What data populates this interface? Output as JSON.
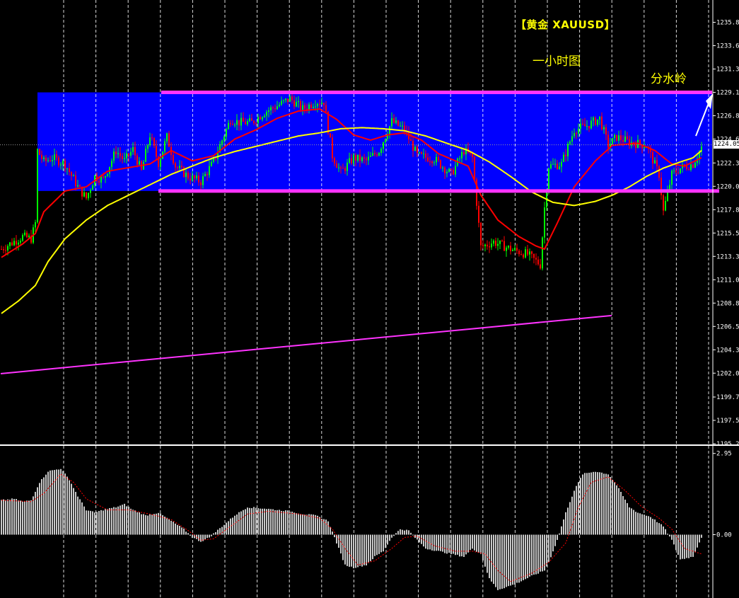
{
  "annotations": {
    "title": "【黄金 XAUUSD】",
    "timeframe": "一小时图",
    "watershed": "分水岭"
  },
  "current_price": "1224.05",
  "colors": {
    "background": "#000000",
    "range_box": "#0000ff",
    "range_lines": "#ff33ff",
    "trend_line": "#ff33ff",
    "bull_candle": "#00ff00",
    "bear_candle": "#ff0000",
    "ma_fast": "#ff0000",
    "ma_slow": "#ffff00",
    "macd_hist": "#c8c8c8",
    "macd_signal": "#ff0000",
    "grid": "#ffffff",
    "text": "#ffffff"
  },
  "chart_data": [
    {
      "type": "candlestick",
      "panel": "price",
      "ylim": [
        1195.25,
        1238.0
      ],
      "y_ticks": [
        "1235.85",
        "1233.60",
        "1231.35",
        "1229.10",
        "1226.85",
        "1224.60",
        "1222.30",
        "1220.05",
        "1217.80",
        "1215.55",
        "1213.30",
        "1211.05",
        "1208.80",
        "1206.55",
        "1204.30",
        "1202.05",
        "1199.75",
        "1197.50",
        "1195.25"
      ],
      "range_box": {
        "upper": 1229.1,
        "lower": 1219.6
      },
      "resistance": 1229.1,
      "support": 1219.6,
      "trend_line": {
        "start_bar": 0,
        "start_price": 1202.0,
        "end_bar": 288,
        "end_price": 1207.6
      },
      "candles": [],
      "anchors": [
        [
          0,
          1214.0
        ],
        [
          4,
          1214.5
        ],
        [
          10,
          1215.2
        ],
        [
          14,
          1215.0
        ],
        [
          16,
          1216.5
        ],
        [
          17,
          1223.5
        ],
        [
          20,
          1222.4
        ],
        [
          24,
          1222.8
        ],
        [
          30,
          1222.2
        ],
        [
          36,
          1220.0
        ],
        [
          40,
          1218.9
        ],
        [
          44,
          1221.0
        ],
        [
          48,
          1220.7
        ],
        [
          54,
          1223.5
        ],
        [
          58,
          1222.5
        ],
        [
          62,
          1223.6
        ],
        [
          66,
          1221.5
        ],
        [
          70,
          1225.0
        ],
        [
          74,
          1222.3
        ],
        [
          78,
          1224.8
        ],
        [
          82,
          1222.0
        ],
        [
          88,
          1221.0
        ],
        [
          94,
          1220.5
        ],
        [
          100,
          1222.4
        ],
        [
          104,
          1224.5
        ],
        [
          108,
          1226.5
        ],
        [
          112,
          1226.2
        ],
        [
          118,
          1226.2
        ],
        [
          124,
          1227.2
        ],
        [
          130,
          1227.8
        ],
        [
          136,
          1228.5
        ],
        [
          142,
          1227.5
        ],
        [
          148,
          1228.2
        ],
        [
          152,
          1228.2
        ],
        [
          156,
          1223.0
        ],
        [
          160,
          1221.4
        ],
        [
          166,
          1222.8
        ],
        [
          172,
          1222.5
        ],
        [
          178,
          1223.5
        ],
        [
          184,
          1226.3
        ],
        [
          190,
          1225.5
        ],
        [
          196,
          1223.0
        ],
        [
          204,
          1222.7
        ],
        [
          212,
          1221.2
        ],
        [
          218,
          1223.5
        ],
        [
          222,
          1222.8
        ],
        [
          226,
          1214.2
        ],
        [
          232,
          1214.7
        ],
        [
          240,
          1214.0
        ],
        [
          248,
          1213.5
        ],
        [
          254,
          1212.5
        ],
        [
          256,
          1218.0
        ],
        [
          258,
          1222.0
        ],
        [
          264,
          1222.2
        ],
        [
          270,
          1225.5
        ],
        [
          276,
          1225.9
        ],
        [
          282,
          1226.6
        ],
        [
          286,
          1224.0
        ],
        [
          290,
          1224.8
        ],
        [
          296,
          1224.3
        ],
        [
          304,
          1224.0
        ],
        [
          310,
          1221.2
        ],
        [
          312,
          1217.6
        ],
        [
          316,
          1221.2
        ],
        [
          320,
          1221.8
        ],
        [
          326,
          1222.2
        ],
        [
          330,
          1223.8
        ]
      ]
    },
    {
      "type": "line",
      "panel": "price",
      "series": [
        {
          "key": "ma_fast",
          "anchors": [
            [
              0,
              1213.2
            ],
            [
              10,
              1214.5
            ],
            [
              16,
              1215.5
            ],
            [
              20,
              1217.6
            ],
            [
              30,
              1219.6
            ],
            [
              40,
              1220.0
            ],
            [
              50,
              1221.5
            ],
            [
              70,
              1222.2
            ],
            [
              80,
              1223.5
            ],
            [
              90,
              1222.5
            ],
            [
              100,
              1223.0
            ],
            [
              110,
              1224.6
            ],
            [
              120,
              1225.5
            ],
            [
              130,
              1226.6
            ],
            [
              140,
              1227.3
            ],
            [
              150,
              1227.5
            ],
            [
              158,
              1226.5
            ],
            [
              166,
              1225.0
            ],
            [
              174,
              1224.5
            ],
            [
              182,
              1225.0
            ],
            [
              190,
              1225.2
            ],
            [
              198,
              1224.5
            ],
            [
              206,
              1223.2
            ],
            [
              214,
              1222.5
            ],
            [
              220,
              1222.0
            ],
            [
              226,
              1219.2
            ],
            [
              234,
              1216.8
            ],
            [
              244,
              1215.2
            ],
            [
              252,
              1214.3
            ],
            [
              256,
              1214.0
            ],
            [
              262,
              1216.5
            ],
            [
              270,
              1220.0
            ],
            [
              280,
              1222.5
            ],
            [
              288,
              1224.0
            ],
            [
              300,
              1224.2
            ],
            [
              308,
              1223.5
            ],
            [
              316,
              1222.2
            ],
            [
              322,
              1222.0
            ],
            [
              330,
              1222.8
            ]
          ]
        },
        {
          "key": "ma_slow",
          "anchors": [
            [
              0,
              1207.8
            ],
            [
              8,
              1209.0
            ],
            [
              16,
              1210.5
            ],
            [
              22,
              1212.8
            ],
            [
              30,
              1215.0
            ],
            [
              40,
              1216.8
            ],
            [
              50,
              1218.2
            ],
            [
              60,
              1219.2
            ],
            [
              70,
              1220.2
            ],
            [
              80,
              1221.2
            ],
            [
              90,
              1222.0
            ],
            [
              100,
              1222.8
            ],
            [
              110,
              1223.4
            ],
            [
              120,
              1223.9
            ],
            [
              130,
              1224.4
            ],
            [
              140,
              1224.9
            ],
            [
              150,
              1225.2
            ],
            [
              160,
              1225.6
            ],
            [
              170,
              1225.7
            ],
            [
              180,
              1225.6
            ],
            [
              190,
              1225.4
            ],
            [
              200,
              1224.9
            ],
            [
              210,
              1224.2
            ],
            [
              220,
              1223.5
            ],
            [
              230,
              1222.4
            ],
            [
              240,
              1221.0
            ],
            [
              250,
              1219.5
            ],
            [
              260,
              1218.5
            ],
            [
              270,
              1218.2
            ],
            [
              280,
              1218.6
            ],
            [
              288,
              1219.2
            ],
            [
              296,
              1220.0
            ],
            [
              304,
              1221.0
            ],
            [
              312,
              1221.8
            ],
            [
              320,
              1222.4
            ],
            [
              326,
              1222.8
            ],
            [
              330,
              1223.5
            ]
          ]
        }
      ]
    },
    {
      "type": "bar",
      "panel": "macd",
      "ylim": [
        -2.3,
        3.2
      ],
      "y_ticks": [
        "2.95",
        "0.00"
      ],
      "hist_anchors": [
        [
          0,
          1.25
        ],
        [
          6,
          1.3
        ],
        [
          10,
          1.2
        ],
        [
          14,
          1.25
        ],
        [
          18,
          1.9
        ],
        [
          22,
          2.3
        ],
        [
          28,
          2.4
        ],
        [
          32,
          2.0
        ],
        [
          36,
          1.4
        ],
        [
          40,
          0.9
        ],
        [
          44,
          0.8
        ],
        [
          48,
          0.9
        ],
        [
          54,
          1.0
        ],
        [
          58,
          1.1
        ],
        [
          62,
          0.9
        ],
        [
          68,
          0.7
        ],
        [
          74,
          0.8
        ],
        [
          80,
          0.5
        ],
        [
          86,
          0.2
        ],
        [
          90,
          -0.1
        ],
        [
          94,
          -0.25
        ],
        [
          98,
          -0.1
        ],
        [
          104,
          0.3
        ],
        [
          110,
          0.7
        ],
        [
          116,
          1.0
        ],
        [
          124,
          0.95
        ],
        [
          130,
          0.9
        ],
        [
          136,
          0.85
        ],
        [
          142,
          0.75
        ],
        [
          148,
          0.7
        ],
        [
          154,
          0.5
        ],
        [
          158,
          -0.3
        ],
        [
          162,
          -1.1
        ],
        [
          166,
          -1.2
        ],
        [
          172,
          -1.1
        ],
        [
          176,
          -0.8
        ],
        [
          180,
          -0.6
        ],
        [
          184,
          -0.1
        ],
        [
          188,
          0.2
        ],
        [
          192,
          0.15
        ],
        [
          196,
          -0.2
        ],
        [
          200,
          -0.5
        ],
        [
          206,
          -0.6
        ],
        [
          212,
          -0.7
        ],
        [
          218,
          -0.8
        ],
        [
          222,
          -0.5
        ],
        [
          226,
          -0.7
        ],
        [
          230,
          -1.6
        ],
        [
          234,
          -2.0
        ],
        [
          242,
          -1.8
        ],
        [
          250,
          -1.5
        ],
        [
          256,
          -1.3
        ],
        [
          258,
          -1.0
        ],
        [
          262,
          -0.2
        ],
        [
          266,
          0.8
        ],
        [
          270,
          1.6
        ],
        [
          274,
          2.2
        ],
        [
          280,
          2.3
        ],
        [
          286,
          2.2
        ],
        [
          290,
          1.8
        ],
        [
          296,
          1.0
        ],
        [
          300,
          0.8
        ],
        [
          306,
          0.65
        ],
        [
          312,
          0.3
        ],
        [
          316,
          -0.2
        ],
        [
          320,
          -0.9
        ],
        [
          326,
          -0.8
        ],
        [
          330,
          -0.1
        ]
      ],
      "signal_anchors": [
        [
          0,
          1.25
        ],
        [
          14,
          1.2
        ],
        [
          20,
          1.5
        ],
        [
          28,
          2.2
        ],
        [
          34,
          1.9
        ],
        [
          40,
          1.3
        ],
        [
          50,
          0.9
        ],
        [
          60,
          0.9
        ],
        [
          70,
          0.75
        ],
        [
          80,
          0.55
        ],
        [
          88,
          0.15
        ],
        [
          94,
          -0.2
        ],
        [
          100,
          -0.15
        ],
        [
          108,
          0.3
        ],
        [
          116,
          0.75
        ],
        [
          126,
          0.85
        ],
        [
          140,
          0.75
        ],
        [
          150,
          0.6
        ],
        [
          156,
          0.2
        ],
        [
          162,
          -0.5
        ],
        [
          168,
          -1.1
        ],
        [
          176,
          -0.95
        ],
        [
          184,
          -0.5
        ],
        [
          190,
          -0.1
        ],
        [
          196,
          -0.05
        ],
        [
          204,
          -0.4
        ],
        [
          214,
          -0.6
        ],
        [
          222,
          -0.6
        ],
        [
          228,
          -0.7
        ],
        [
          234,
          -1.3
        ],
        [
          240,
          -1.7
        ],
        [
          250,
          -1.4
        ],
        [
          258,
          -1.0
        ],
        [
          266,
          -0.3
        ],
        [
          272,
          1.0
        ],
        [
          278,
          1.9
        ],
        [
          286,
          2.1
        ],
        [
          294,
          1.6
        ],
        [
          302,
          1.0
        ],
        [
          310,
          0.6
        ],
        [
          316,
          0.2
        ],
        [
          322,
          -0.5
        ],
        [
          330,
          -0.7
        ]
      ]
    }
  ]
}
